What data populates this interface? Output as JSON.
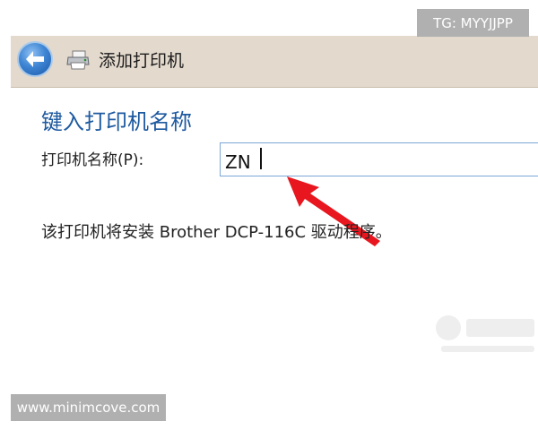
{
  "badges": {
    "tg": "TG: MYYJJPP",
    "url": "www.minimcove.com"
  },
  "titlebar": {
    "title": "添加打印机"
  },
  "content": {
    "heading": "键入打印机名称",
    "name_label": "打印机名称(P):",
    "name_value": "ZN",
    "driver_message": "该打印机将安装 Brother DCP-116C 驱动程序。"
  },
  "colors": {
    "heading": "#1e5aa0",
    "arrow": "#e8161e",
    "titlebar_bg": "#e3d9cd"
  }
}
